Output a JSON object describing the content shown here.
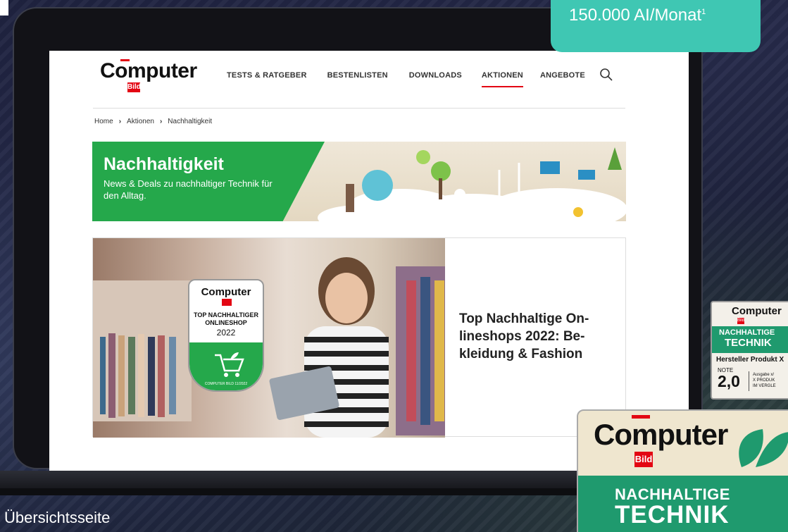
{
  "stat_bubble": {
    "text": "150.000 AI/Monat",
    "footnote": "1"
  },
  "caption": "Übersichtsseite",
  "site": {
    "logo_word": "Computer",
    "logo_bild": "Bild",
    "nav": [
      {
        "label": "TESTS & RATGEBER",
        "active": false
      },
      {
        "label": "BESTENLISTEN",
        "active": false
      },
      {
        "label": "DOWNLOADS",
        "active": false
      },
      {
        "label": "AKTIONEN",
        "active": true
      },
      {
        "label": "ANGEBOTE",
        "active": false
      }
    ],
    "search_icon": "search-icon",
    "breadcrumb": [
      "Home",
      "Aktionen",
      "Nachhaltigkeit"
    ]
  },
  "banner": {
    "title": "Nachhaltigkeit",
    "subtitle": "News & Deals zu nachhaltiger Technik für den Alltag."
  },
  "article": {
    "title": "Top Nachhaltige On-lineshops 2022: Be-kleidung & Fashion",
    "seal": {
      "brand": "Computer",
      "line1": "TOP NACHHALTIGER",
      "line2": "ONLINESHOP",
      "year": "2022",
      "footer": "COMPUTER BILD 11/2022"
    }
  },
  "badge_small": {
    "brand": "Computer",
    "bild": "Bild",
    "title1": "NACHHALTIGE",
    "title2": "TECHNIK",
    "product": "Hersteller Produkt X",
    "note_label": "NOTE",
    "note": "2,0",
    "small1": "Ausgabe x/",
    "small2": "X PRODUK",
    "small3": "IM VERGLE"
  },
  "badge_big": {
    "brand": "Computer",
    "bild": "Bild",
    "title1": "NACHHALTIGE",
    "title2": "TECHNIK"
  },
  "colors": {
    "brand_red": "#e30613",
    "green": "#25a84b",
    "teal": "#3fc7b3"
  }
}
